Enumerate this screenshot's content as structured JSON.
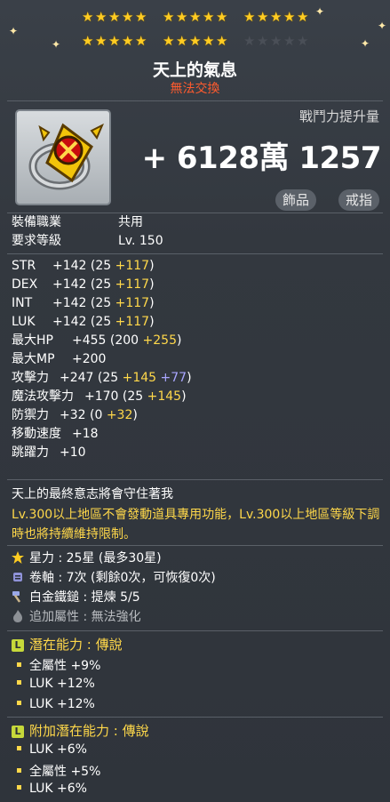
{
  "item": {
    "name": "天上的氣息",
    "trade_status": "無法交換",
    "star_force": 25,
    "star_max": 30
  },
  "combat_power": {
    "label": "戰鬥力提升量",
    "value": "+ 6128萬 1257"
  },
  "tags": [
    "飾品",
    "戒指"
  ],
  "requirements": [
    {
      "label": "裝備職業",
      "value": "共用"
    },
    {
      "label": "要求等級",
      "value": "Lv. 150"
    }
  ],
  "stats": [
    {
      "label": "STR",
      "total": "+142",
      "open": " (25 ",
      "bonus": "+117",
      "extra": "",
      "close": ")"
    },
    {
      "label": "DEX",
      "total": "+142",
      "open": " (25 ",
      "bonus": "+117",
      "extra": "",
      "close": ")"
    },
    {
      "label": "INT",
      "total": "+142",
      "open": " (25 ",
      "bonus": "+117",
      "extra": "",
      "close": ")"
    },
    {
      "label": "LUK",
      "total": "+142",
      "open": " (25 ",
      "bonus": "+117",
      "extra": "",
      "close": ")"
    },
    {
      "label": "最大HP",
      "total": "+455",
      "open": " (200 ",
      "bonus": "+255",
      "extra": "",
      "close": ")"
    },
    {
      "label": "最大MP",
      "total": "+200",
      "open": "",
      "bonus": "",
      "extra": "",
      "close": ""
    },
    {
      "label": "攻擊力",
      "total": "+247",
      "open": " (25 ",
      "bonus": "+145",
      "extra": " +77",
      "close": ")"
    },
    {
      "label": "魔法攻擊力",
      "total": "+170",
      "open": " (25 ",
      "bonus": "+145",
      "extra": "",
      "close": ")"
    },
    {
      "label": "防禦力",
      "total": "+32",
      "open": " (0 ",
      "bonus": "+32",
      "extra": "",
      "close": ")"
    },
    {
      "label": "移動速度",
      "total": "+18",
      "open": "",
      "bonus": "",
      "extra": "",
      "close": ""
    },
    {
      "label": "跳躍力",
      "total": "+10",
      "open": "",
      "bonus": "",
      "extra": "",
      "close": ""
    }
  ],
  "description": "天上的最終意志將會守住著我",
  "notice": "Lv.300以上地區不會發動道具專用功能，Lv.300以上地區等級下調時也將持續維持限制。",
  "info": [
    {
      "icon": "star-icon",
      "label": "星力",
      "value": "25星 (最多30星)"
    },
    {
      "icon": "scroll-icon",
      "label": "卷軸",
      "value": "7次 (剩餘0次，可恢復0次)"
    },
    {
      "icon": "hammer-icon",
      "label": "白金鐵鎚",
      "value": "提煉 5/5"
    },
    {
      "icon": "flame-icon",
      "label": "追加屬性",
      "value": "無法強化"
    }
  ],
  "potential": {
    "badge": "L",
    "title": "潛在能力 : 傳說",
    "lines": [
      "全屬性 +9%",
      "LUK +12%",
      "LUK +12%"
    ]
  },
  "additional_potential": {
    "badge": "L",
    "title": "附加潛在能力 : 傳說",
    "lines": [
      "LUK +6%",
      "全屬性 +5%",
      "LUK +6%"
    ]
  },
  "colors": {
    "accent": "#ffd84a",
    "bonus_purple": "#a9a6ff",
    "untradeable": "#ff5b2e"
  }
}
